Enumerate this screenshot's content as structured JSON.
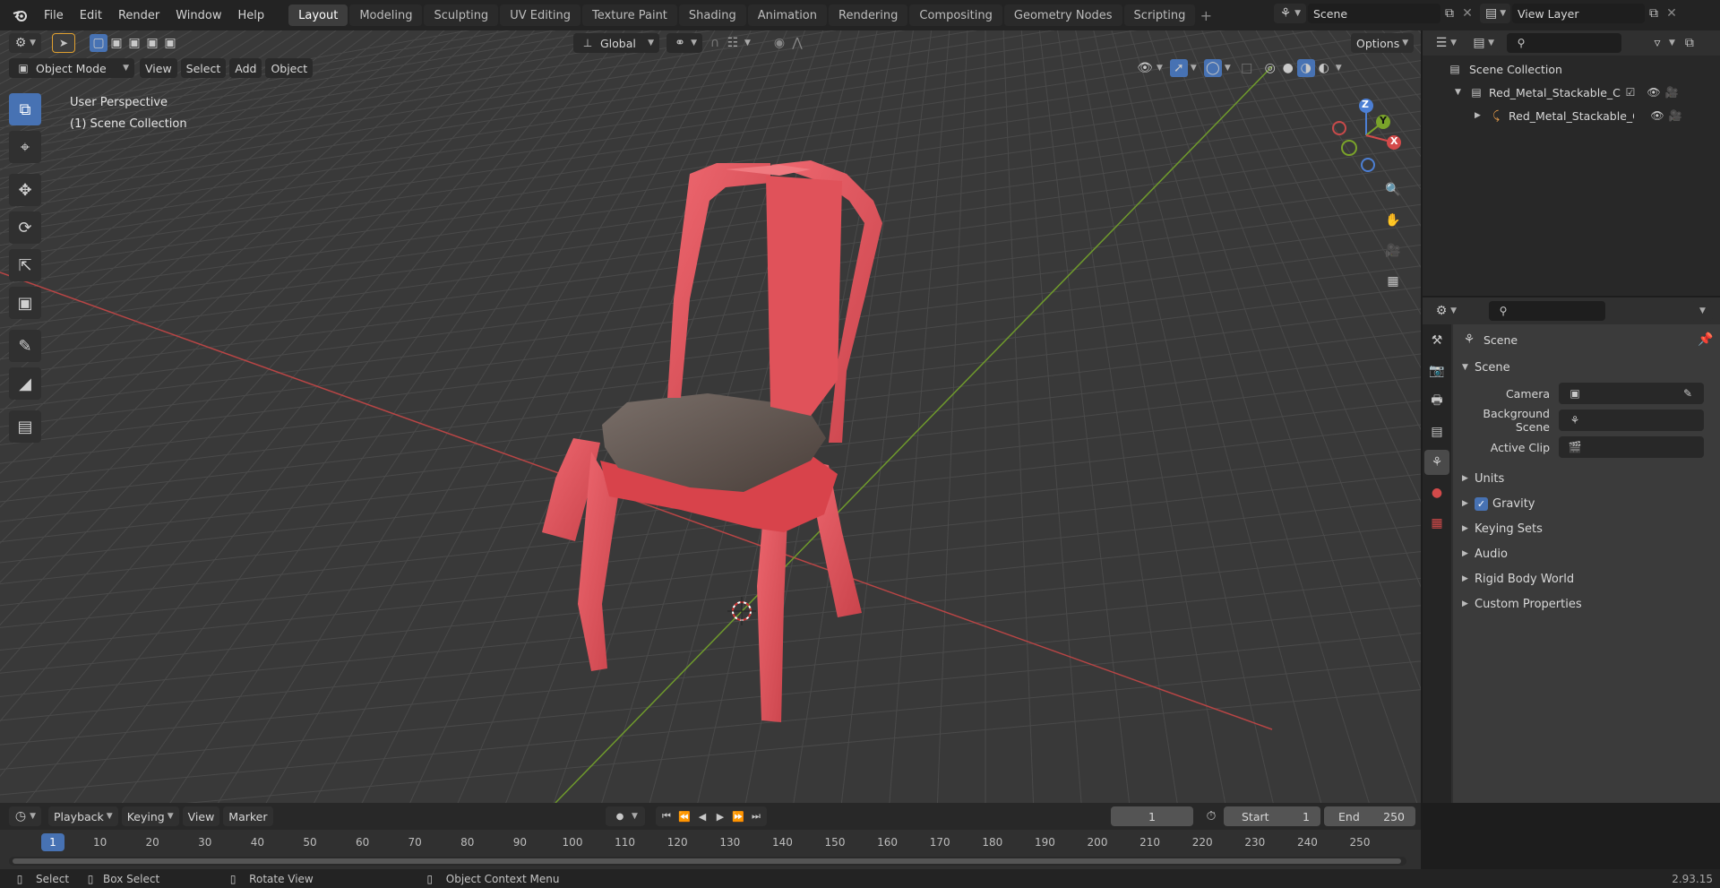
{
  "menu": [
    "File",
    "Edit",
    "Render",
    "Window",
    "Help"
  ],
  "workspaces": [
    "Layout",
    "Modeling",
    "Sculpting",
    "UV Editing",
    "Texture Paint",
    "Shading",
    "Animation",
    "Rendering",
    "Compositing",
    "Geometry Nodes",
    "Scripting"
  ],
  "active_workspace": "Layout",
  "scene_selector": "Scene",
  "view_layer": "View Layer",
  "viewport": {
    "transform_orientation": "Global",
    "options_label": "Options",
    "mode": "Object Mode",
    "header_menus": [
      "View",
      "Select",
      "Add",
      "Object"
    ],
    "overlay_title": "User Perspective",
    "overlay_subtitle": "(1) Scene Collection",
    "gizmo_axes": {
      "x": "X",
      "y": "Y",
      "z": "Z"
    }
  },
  "outliner": {
    "root": "Scene Collection",
    "collection": "Red_Metal_Stackable_Chair_W",
    "object": "Red_Metal_Stackable_Ch"
  },
  "properties": {
    "header": "Scene",
    "section": "Scene",
    "camera_label": "Camera",
    "background_scene_label": "Background Scene",
    "active_clip_label": "Active Clip",
    "subsections": [
      "Units",
      "Gravity",
      "Keying Sets",
      "Audio",
      "Rigid Body World",
      "Custom Properties"
    ],
    "gravity_checked": true
  },
  "timeline": {
    "menus": [
      "Playback",
      "Keying",
      "View",
      "Marker"
    ],
    "current_frame": "1",
    "start_label": "Start",
    "start_value": "1",
    "end_label": "End",
    "end_value": "250",
    "ruler": [
      "1",
      "10",
      "20",
      "30",
      "40",
      "50",
      "60",
      "70",
      "80",
      "90",
      "100",
      "110",
      "120",
      "130",
      "140",
      "150",
      "160",
      "170",
      "180",
      "190",
      "200",
      "210",
      "220",
      "230",
      "240",
      "250"
    ]
  },
  "statusbar": {
    "select": "Select",
    "box_select": "Box Select",
    "rotate_view": "Rotate View",
    "context_menu": "Object Context Menu",
    "version": "2.93.15"
  },
  "colors": {
    "accent": "#4772b3",
    "x_axis": "#c94a4a",
    "y_axis": "#7aa32a",
    "chair": "#e0525a",
    "seat": "#5a4f4a"
  }
}
